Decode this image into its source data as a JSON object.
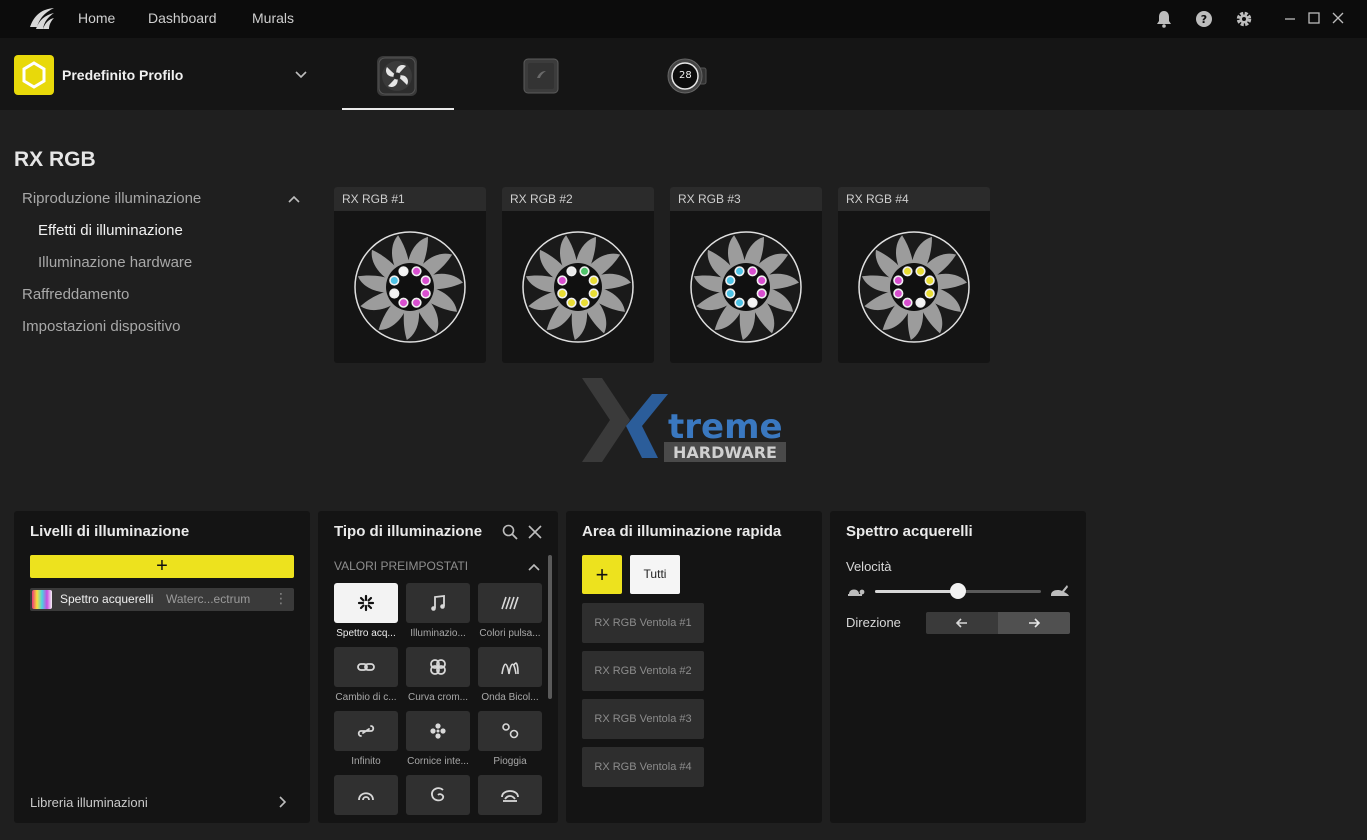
{
  "nav": {
    "home": "Home",
    "dashboard": "Dashboard",
    "murals": "Murals"
  },
  "profile": {
    "name": "Predefinito Profilo"
  },
  "devices": {
    "cooler_display": "28"
  },
  "page": {
    "title": "RX RGB"
  },
  "sidebar": {
    "items": [
      {
        "label": "Riproduzione illuminazione"
      },
      {
        "label": "Effetti di illuminazione"
      },
      {
        "label": "Illuminazione hardware"
      },
      {
        "label": "Raffreddamento"
      },
      {
        "label": "Impostazioni dispositivo"
      }
    ]
  },
  "fans": [
    {
      "label": "RX RGB #1",
      "leds": [
        "#f4f4f4",
        "#d94fd0",
        "#d94fd0",
        "#d94fd0",
        "#d94fd0",
        "#d94fd0",
        "#f4f4f4",
        "#4ec3e6"
      ]
    },
    {
      "label": "RX RGB #2",
      "leds": [
        "#e9e9e9",
        "#4fc36a",
        "#e9dd35",
        "#e9dd35",
        "#e9dd35",
        "#e9dd35",
        "#e9dd35",
        "#d94fd0"
      ]
    },
    {
      "label": "RX RGB #3",
      "leds": [
        "#4ec3e6",
        "#d94fd0",
        "#d94fd0",
        "#d94fd0",
        "#f4f4f4",
        "#4ec3e6",
        "#4ec3e6",
        "#4ec3e6"
      ]
    },
    {
      "label": "RX RGB #4",
      "leds": [
        "#e9dd35",
        "#e9dd35",
        "#e9dd35",
        "#e9dd35",
        "#f4f4f4",
        "#d94fd0",
        "#d94fd0",
        "#d94fd0"
      ]
    }
  ],
  "watermark": {
    "brand": "treme",
    "sub": "HARDWARE"
  },
  "layers": {
    "title": "Livelli di illuminazione",
    "add_label": "+",
    "items": [
      {
        "name": "Spettro acquerelli",
        "sub": "Waterc...ectrum",
        "menu": "⋮"
      }
    ],
    "library_label": "Libreria illuminazioni"
  },
  "types": {
    "title": "Tipo di illuminazione",
    "presets_label": "VALORI PREIMPOSTATI",
    "tiles": [
      {
        "label": "Spettro acq...",
        "icon": "spectrum-icon"
      },
      {
        "label": "Illuminazio...",
        "icon": "music-icon"
      },
      {
        "label": "Colori pulsa...",
        "icon": "pulse-icon"
      },
      {
        "label": "Cambio di c...",
        "icon": "link-icon"
      },
      {
        "label": "Curva crom...",
        "icon": "chroma-curve-icon"
      },
      {
        "label": "Onda Bicol...",
        "icon": "wave-icon"
      },
      {
        "label": "Infinito",
        "icon": "infinity-icon"
      },
      {
        "label": "Cornice inte...",
        "icon": "frame-icon"
      },
      {
        "label": "Pioggia",
        "icon": "rain-icon"
      },
      {
        "label": "",
        "icon": "arc-icon"
      },
      {
        "label": "",
        "icon": "spiral-icon"
      },
      {
        "label": "",
        "icon": "layers-icon"
      }
    ]
  },
  "quick": {
    "title": "Area di illuminazione rapida",
    "add_label": "+",
    "all_label": "Tutti",
    "zones": [
      "RX RGB Ventola #1",
      "RX RGB Ventola #2",
      "RX RGB Ventola #3",
      "RX RGB Ventola #4"
    ]
  },
  "effect": {
    "title": "Spettro acquerelli",
    "speed_label": "Velocità",
    "speed_value": 0.5,
    "direction_label": "Direzione",
    "direction": "right"
  },
  "colors": {
    "accent": "#ede21e"
  }
}
